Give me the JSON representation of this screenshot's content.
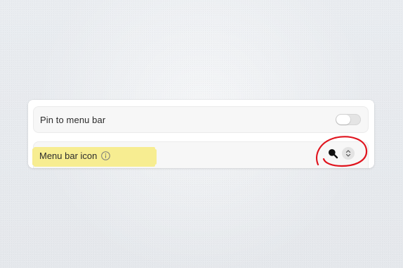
{
  "settings": {
    "pin_to_menu_bar": {
      "label": "Pin to menu bar",
      "enabled": false
    },
    "menu_bar_icon": {
      "label": "Menu bar icon",
      "info_icon": "info-icon",
      "selected_icon": "search-icon",
      "picker_icon": "chevron-up-down-icon"
    }
  },
  "annotations": {
    "highlight_color": "#f8ec87",
    "circle_color": "#e0141e"
  },
  "colors": {
    "background": "#e8ebef",
    "panel": "#ffffff",
    "row": "#f7f7f7",
    "text": "#2b2b2b"
  }
}
